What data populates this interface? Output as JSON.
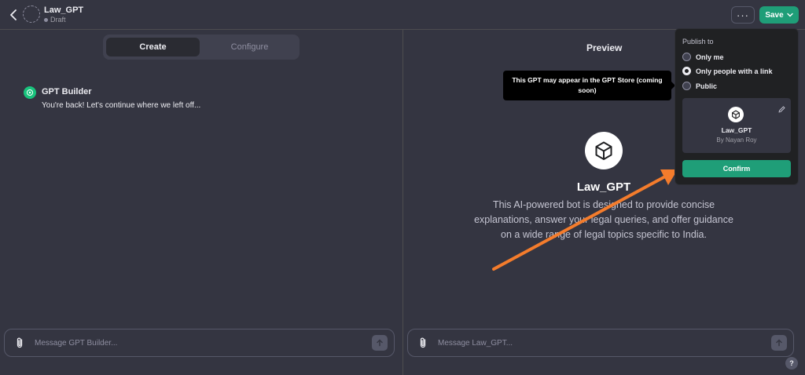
{
  "header": {
    "title": "Law_GPT",
    "status": "Draft",
    "more_label": "···",
    "save_label": "Save"
  },
  "tabs": [
    {
      "label": "Create",
      "active": true
    },
    {
      "label": "Configure",
      "active": false
    }
  ],
  "builder": {
    "name": "GPT Builder",
    "message": "You're back! Let's continue where we left off..."
  },
  "left_input": {
    "placeholder": "Message GPT Builder..."
  },
  "preview": {
    "title": "Preview",
    "gpt_name": "Law_GPT",
    "description": "This AI-powered bot is designed to provide concise explanations, answer your legal queries, and offer guidance on a wide range of legal topics specific to India.",
    "tooltip": "This GPT may appear in the GPT Store (coming soon)",
    "input_placeholder": "Message Law_GPT..."
  },
  "publish": {
    "heading": "Publish to",
    "options": [
      {
        "label": "Only me",
        "checked": false
      },
      {
        "label": "Only people with a link",
        "checked": true
      },
      {
        "label": "Public",
        "checked": false
      }
    ],
    "card_name": "Law_GPT",
    "card_author": "By Nayan Roy",
    "confirm_label": "Confirm"
  },
  "help_label": "?",
  "colors": {
    "background": "#343541",
    "accent": "#1f9e78",
    "annotation_arrow": "#f47c2c"
  }
}
